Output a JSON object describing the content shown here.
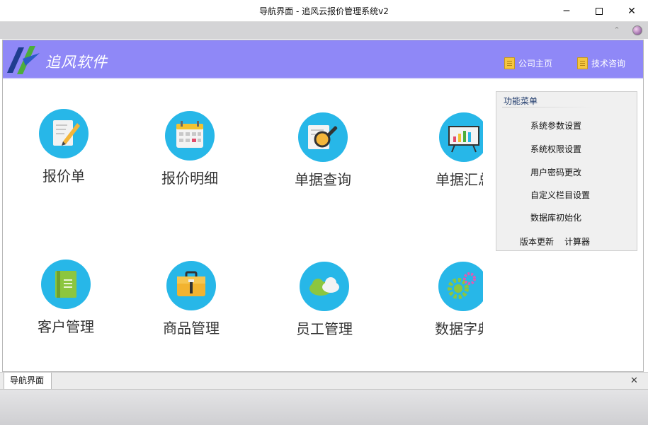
{
  "window": {
    "title": "导航界面 - 追风云报价管理系统v2",
    "minimize_glyph": "─",
    "close_glyph": "✕"
  },
  "header": {
    "brand": "追风软件",
    "links": [
      {
        "label": "公司主页",
        "icon": "document-icon"
      },
      {
        "label": "技术咨询",
        "icon": "document-icon"
      }
    ],
    "accent": "#8f88f7"
  },
  "tiles": [
    {
      "label": "报价单",
      "icon": "edit-document-icon"
    },
    {
      "label": "报价明细",
      "icon": "calendar-icon"
    },
    {
      "label": "单据查询",
      "icon": "magnifier-icon"
    },
    {
      "label": "单据汇总",
      "icon": "chart-board-icon"
    },
    {
      "label": "客户管理",
      "icon": "address-book-icon"
    },
    {
      "label": "商品管理",
      "icon": "briefcase-icon"
    },
    {
      "label": "员工管理",
      "icon": "cloud-icon"
    },
    {
      "label": "数据字典",
      "icon": "gears-icon"
    }
  ],
  "menu": {
    "title": "功能菜单",
    "items": [
      "系统参数设置",
      "系统权限设置",
      "用户密码更改",
      "自定义栏目设置",
      "数据库初始化"
    ],
    "bottom_items": [
      "版本更新",
      "计算器"
    ]
  },
  "tabs": [
    {
      "label": "导航界面"
    }
  ],
  "colors": {
    "tile_circle": "#27b7e8",
    "banner": "#8f88f7"
  }
}
